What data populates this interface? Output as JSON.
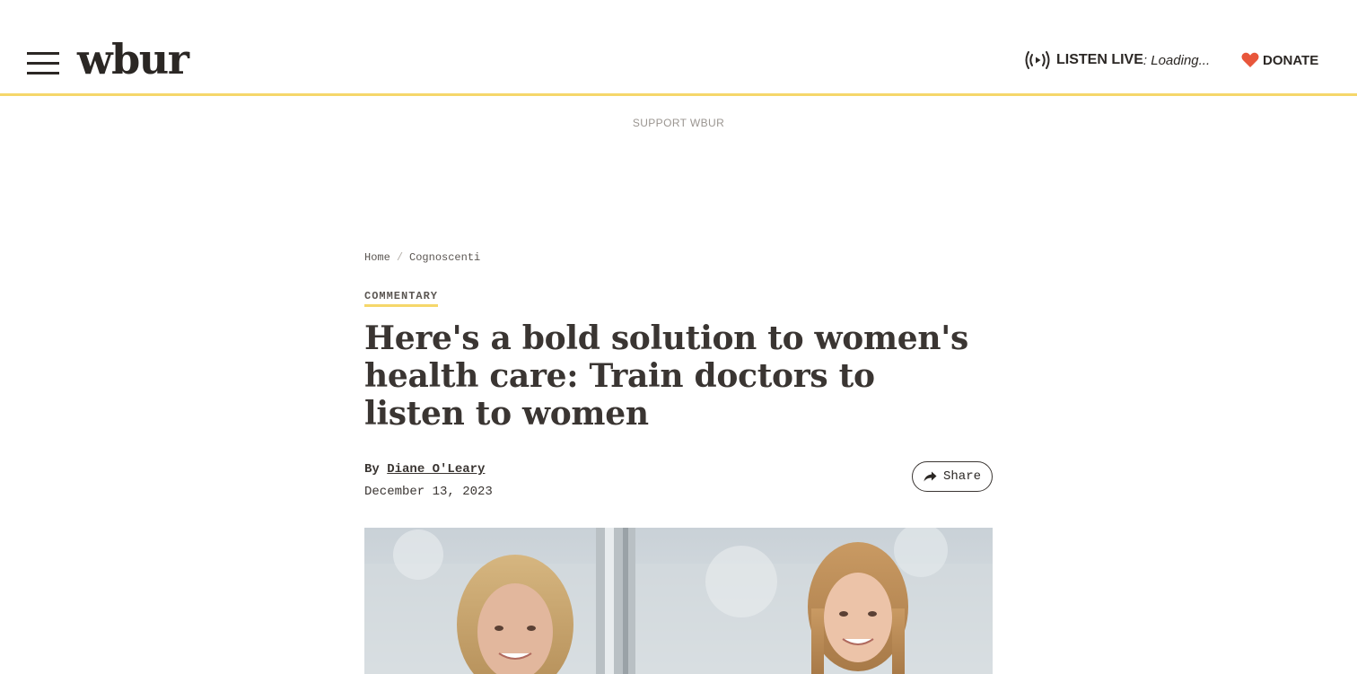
{
  "header": {
    "logo": "wbur",
    "listen_live_label": "LISTEN LIVE",
    "listen_live_status": ": Loading...",
    "donate_label": "DONATE"
  },
  "ad": {
    "label": "SUPPORT WBUR"
  },
  "breadcrumb": {
    "home": "Home",
    "separator": "/",
    "section": "Cognoscenti"
  },
  "article": {
    "tag": "COMMENTARY",
    "headline": "Here's a bold solution to women's health care: Train doctors to listen to women",
    "byline_prefix": "By",
    "author": "Diane O'Leary",
    "date": "December 13, 2023",
    "share_label": "Share"
  },
  "colors": {
    "accent_yellow": "#f5d76a",
    "heart_red": "#e8563b",
    "text_dark": "#3a3532"
  },
  "icons": {
    "menu": "hamburger-menu-icon",
    "listen": "broadcast-icon",
    "donate": "heart-icon",
    "share": "share-arrow-icon"
  }
}
